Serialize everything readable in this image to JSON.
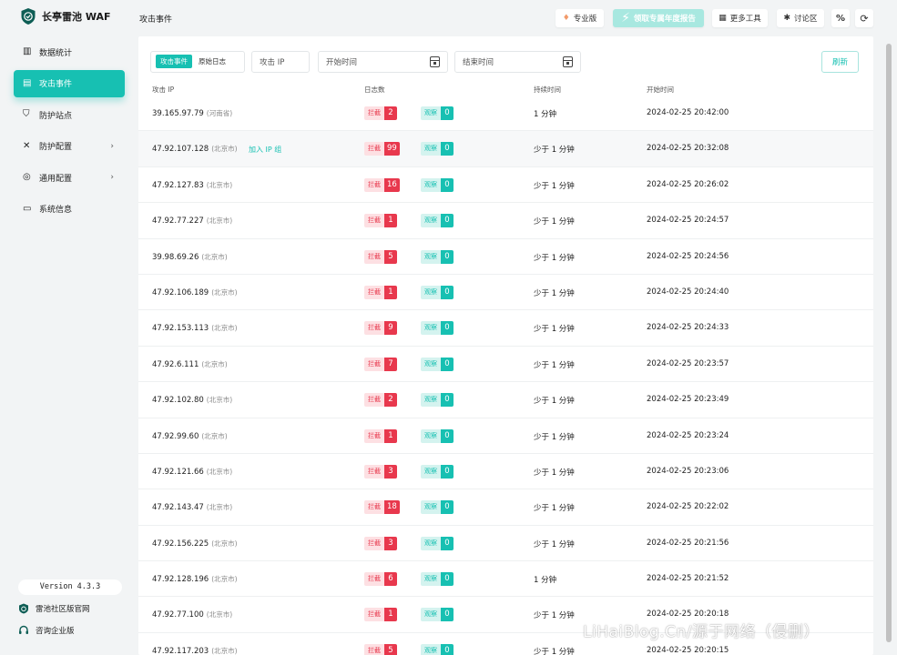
{
  "app": {
    "name": "长亭雷池 WAF",
    "version": "Version 4.3.3"
  },
  "sidebar": {
    "items": [
      {
        "label": "数据统计",
        "icon": "bar-chart-icon",
        "active": false,
        "has_children": false
      },
      {
        "label": "攻击事件",
        "icon": "event-log-icon",
        "active": true,
        "has_children": false
      },
      {
        "label": "防护站点",
        "icon": "shield-icon",
        "active": false,
        "has_children": false
      },
      {
        "label": "防护配置",
        "icon": "tools-icon",
        "active": false,
        "has_children": true
      },
      {
        "label": "通用配置",
        "icon": "settings-icon",
        "active": false,
        "has_children": true
      },
      {
        "label": "系统信息",
        "icon": "monitor-icon",
        "active": false,
        "has_children": false
      }
    ],
    "community_link": "雷池社区版官网",
    "enterprise_link": "咨询企业版"
  },
  "header": {
    "title": "攻击事件",
    "pro_label": "专业版",
    "promo_label": "领取专属年度报告",
    "tools_label": "更多工具",
    "forum_label": "讨论区"
  },
  "filters": {
    "tab_events": "攻击事件",
    "tab_raw_logs": "原始日志",
    "ip_placeholder": "攻击 IP",
    "start_placeholder": "开始时间",
    "end_placeholder": "结束时间",
    "refresh_label": "刷新"
  },
  "table": {
    "headers": {
      "ip": "攻击 IP",
      "logs": "日志数",
      "duration": "持续时间",
      "start": "开始时间"
    },
    "block_label": "拦截",
    "watch_label": "观察",
    "join_label": "加入 IP 组",
    "rows": [
      {
        "ip": "39.165.97.79",
        "loc": "(河南省)",
        "block": "2",
        "watch": "0",
        "duration": "1 分钟",
        "start": "2024-02-25 20:42:00"
      },
      {
        "ip": "47.92.107.128",
        "loc": "(北京市)",
        "block": "99",
        "watch": "0",
        "duration": "少于 1 分钟",
        "start": "2024-02-25 20:32:08"
      },
      {
        "ip": "47.92.127.83",
        "loc": "(北京市)",
        "block": "16",
        "watch": "0",
        "duration": "少于 1 分钟",
        "start": "2024-02-25 20:26:02"
      },
      {
        "ip": "47.92.77.227",
        "loc": "(北京市)",
        "block": "1",
        "watch": "0",
        "duration": "少于 1 分钟",
        "start": "2024-02-25 20:24:57"
      },
      {
        "ip": "39.98.69.26",
        "loc": "(北京市)",
        "block": "5",
        "watch": "0",
        "duration": "少于 1 分钟",
        "start": "2024-02-25 20:24:56"
      },
      {
        "ip": "47.92.106.189",
        "loc": "(北京市)",
        "block": "1",
        "watch": "0",
        "duration": "少于 1 分钟",
        "start": "2024-02-25 20:24:40"
      },
      {
        "ip": "47.92.153.113",
        "loc": "(北京市)",
        "block": "9",
        "watch": "0",
        "duration": "少于 1 分钟",
        "start": "2024-02-25 20:24:33"
      },
      {
        "ip": "47.92.6.111",
        "loc": "(北京市)",
        "block": "7",
        "watch": "0",
        "duration": "少于 1 分钟",
        "start": "2024-02-25 20:23:57"
      },
      {
        "ip": "47.92.102.80",
        "loc": "(北京市)",
        "block": "2",
        "watch": "0",
        "duration": "少于 1 分钟",
        "start": "2024-02-25 20:23:49"
      },
      {
        "ip": "47.92.99.60",
        "loc": "(北京市)",
        "block": "1",
        "watch": "0",
        "duration": "少于 1 分钟",
        "start": "2024-02-25 20:23:24"
      },
      {
        "ip": "47.92.121.66",
        "loc": "(北京市)",
        "block": "3",
        "watch": "0",
        "duration": "少于 1 分钟",
        "start": "2024-02-25 20:23:06"
      },
      {
        "ip": "47.92.143.47",
        "loc": "(北京市)",
        "block": "18",
        "watch": "0",
        "duration": "少于 1 分钟",
        "start": "2024-02-25 20:22:02"
      },
      {
        "ip": "47.92.156.225",
        "loc": "(北京市)",
        "block": "3",
        "watch": "0",
        "duration": "少于 1 分钟",
        "start": "2024-02-25 20:21:56"
      },
      {
        "ip": "47.92.128.196",
        "loc": "(北京市)",
        "block": "6",
        "watch": "0",
        "duration": "1 分钟",
        "start": "2024-02-25 20:21:52"
      },
      {
        "ip": "47.92.77.100",
        "loc": "(北京市)",
        "block": "1",
        "watch": "0",
        "duration": "少于 1 分钟",
        "start": "2024-02-25 20:20:18"
      },
      {
        "ip": "47.92.117.203",
        "loc": "(北京市)",
        "block": "5",
        "watch": "0",
        "duration": "少于 1 分钟",
        "start": "2024-02-25 20:20:15"
      }
    ]
  },
  "watermark": "LiHaiBlog.Cn/源于网络（侵删）",
  "colors": {
    "accent": "#17c0b2",
    "danger": "#e8384d",
    "promo": "#a8e8e0"
  }
}
